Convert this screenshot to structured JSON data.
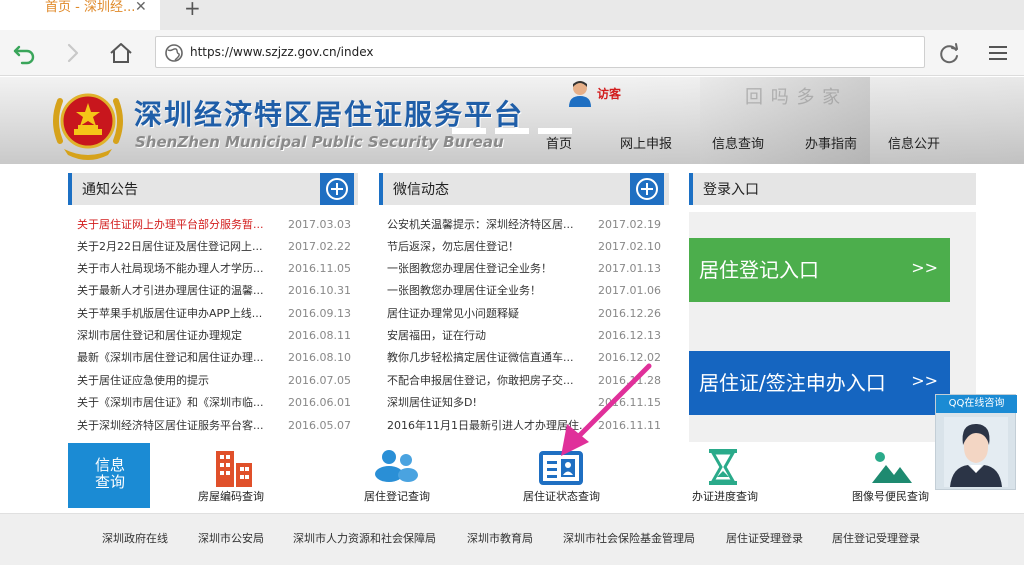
{
  "browser": {
    "tab_title": "首页 - 深圳经...",
    "tab_close": "✕",
    "new_tab": "+",
    "url": "https://www.szjzz.gov.cn/index"
  },
  "header": {
    "title": "深圳经济特区居住证服务平台",
    "subtitle": "ShenZhen Municipal Public Security Bureau",
    "ghost_text": "回 吗 多 家",
    "visitor": "访客",
    "nav": [
      "首页",
      "网上申报",
      "信息查询",
      "办事指南",
      "信息公开"
    ]
  },
  "notices": {
    "title": "通知公告",
    "items": [
      {
        "title": "关于居住证网上办理平台部分服务暂...",
        "date": "2017.03.03",
        "hot": true
      },
      {
        "title": "关于2月22日居住证及居住登记网上...",
        "date": "2017.02.22",
        "hot": false
      },
      {
        "title": "关于市人社局现场不能办理人才学历...",
        "date": "2016.11.05",
        "hot": false
      },
      {
        "title": "关于最新人才引进办理居住证的温馨...",
        "date": "2016.10.31",
        "hot": false
      },
      {
        "title": "关于苹果手机版居住证申办APP上线...",
        "date": "2016.09.13",
        "hot": false
      },
      {
        "title": "深圳市居住登记和居住证办理规定",
        "date": "2016.08.11",
        "hot": false
      },
      {
        "title": "最新《深圳市居住登记和居住证办理...",
        "date": "2016.08.10",
        "hot": false
      },
      {
        "title": "关于居住证应急使用的提示",
        "date": "2016.07.05",
        "hot": false
      },
      {
        "title": "关于《深圳市居住证》和《深圳市临...",
        "date": "2016.06.01",
        "hot": false
      },
      {
        "title": "关于深圳经济特区居住证服务平台客...",
        "date": "2016.05.07",
        "hot": false
      }
    ]
  },
  "wechat": {
    "title": "微信动态",
    "items": [
      {
        "title": "公安机关温馨提示：深圳经济特区居...",
        "date": "2017.02.19"
      },
      {
        "title": "节后返深，勿忘居住登记！",
        "date": "2017.02.10"
      },
      {
        "title": "一张图教您办理居住登记全业务！",
        "date": "2017.01.13"
      },
      {
        "title": "一张图教您办理居住证全业务！",
        "date": "2017.01.06"
      },
      {
        "title": "居住证办理常见小问题释疑",
        "date": "2016.12.26"
      },
      {
        "title": "安居福田，证在行动",
        "date": "2016.12.13"
      },
      {
        "title": "教你几步轻松搞定居住证微信直通车...",
        "date": "2016.12.02"
      },
      {
        "title": "不配合申报居住登记，你敢把房子交...",
        "date": "2016.11.28"
      },
      {
        "title": "深圳居住证知多D!",
        "date": "2016.11.15"
      },
      {
        "title": "2016年11月1日最新引进人才办理居住...",
        "date": "2016.11.11"
      }
    ]
  },
  "login": {
    "title": "登录入口",
    "entry1": "居住登记入口",
    "entry2": "居住证/签注申办入口",
    "arrow": ">>"
  },
  "query": {
    "tag": "信息查询",
    "items": [
      {
        "label": "房屋编码查询",
        "icon": "building-icon"
      },
      {
        "label": "居住登记查询",
        "icon": "users-icon"
      },
      {
        "label": "居住证状态查询",
        "icon": "id-card-icon"
      },
      {
        "label": "办证进度查询",
        "icon": "hourglass-icon"
      },
      {
        "label": "图像号便民查询",
        "icon": "landscape-icon"
      }
    ]
  },
  "footer": {
    "links": [
      "深圳政府在线",
      "深圳市公安局",
      "深圳市人力资源和社会保障局",
      "深圳市教育局",
      "深圳市社会保险基金管理局",
      "居住证受理登录",
      "居住登记受理登录"
    ]
  },
  "qq": {
    "label": "QQ在线咨询"
  },
  "colors": {
    "brand_blue": "#1f6fc2",
    "hot_red": "#d21d1d",
    "entry_green": "#4cae4c",
    "entry_blue": "#1565c0",
    "annotation_pink": "#e0309a"
  }
}
